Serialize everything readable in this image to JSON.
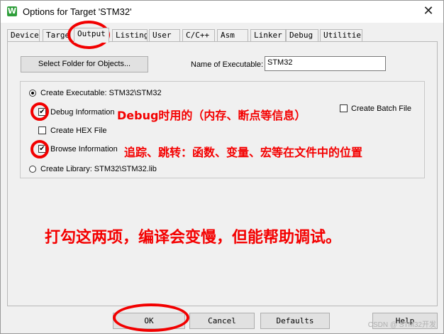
{
  "window": {
    "title": "Options for Target 'STM32'",
    "app_icon_glyph": "W"
  },
  "tabs": [
    "Device",
    "Target",
    "Output",
    "Listing",
    "User",
    "C/C++",
    "Asm",
    "Linker",
    "Debug",
    "Utilities"
  ],
  "active_tab": "Output",
  "output": {
    "select_folder_label": "Select Folder for Objects...",
    "name_label": "Name of Executable:",
    "name_value": "STM32",
    "create_executable_label": "Create Executable:  STM32\\STM32",
    "debug_info_label": "Debug Information",
    "create_hex_label": "Create HEX File",
    "browse_info_label": "Browse Information",
    "create_library_label": "Create Library:  STM32\\STM32.lib",
    "create_batch_label": "Create Batch File",
    "create_executable_selected": true,
    "debug_info_checked": true,
    "create_hex_checked": false,
    "browse_info_checked": true,
    "create_batch_checked": false
  },
  "buttons": {
    "ok": "OK",
    "cancel": "Cancel",
    "defaults": "Defaults",
    "help": "Help"
  },
  "annotations": {
    "debug_note": "Debug时用的（内存、断点等信息）",
    "browse_note": "追踪、跳转：函数、变量、宏等在文件中的位置",
    "summary": "打勾这两项，编译会变慢，但能帮助调试。"
  },
  "watermark": "CSDN @ STM32开发",
  "colors": {
    "annotation_red": "#f40000",
    "dialog_bg": "#f0f0f0"
  }
}
